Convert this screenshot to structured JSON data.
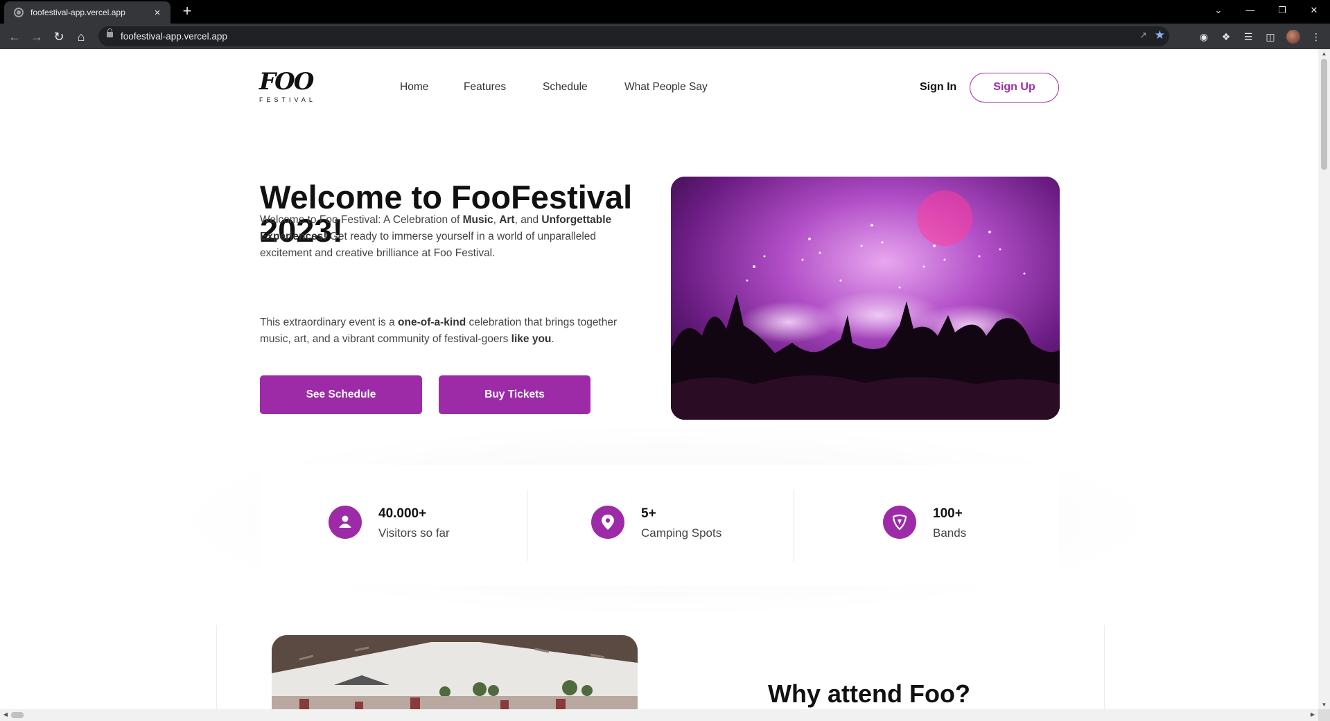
{
  "browser": {
    "tab_title": "foofestival-app.vercel.app",
    "url": "foofestival-app.vercel.app",
    "new_tab": "+",
    "tab_close": "×"
  },
  "site": {
    "logo_script": "FOO",
    "logo_sub": "FESTIVAL",
    "nav": [
      "Home",
      "Features",
      "Schedule",
      "What People Say"
    ],
    "sign_in": "Sign In",
    "sign_up": "Sign Up"
  },
  "hero": {
    "title_prefix": "Welcome to ",
    "title_brand": "FooFestival",
    "title_year": "2023!",
    "p1": {
      "t1": "Welcome to Foo Festival: A Celebration of ",
      "b1": "Music",
      "t2": ", ",
      "b2": "Art",
      "t3": ", and ",
      "b3": "Unforgettable Experiences!",
      "t4": " Get ready to immerse yourself in a world of unparalleled excitement and creative brilliance at Foo Festival."
    },
    "p2": {
      "t1": "This extraordinary event is a ",
      "b1": "one-of-a-kind",
      "t2": " celebration that brings together music, art, and a vibrant community of festival-goers ",
      "b2": "like you",
      "t3": "."
    },
    "btn_schedule": "See Schedule",
    "btn_tickets": "Buy Tickets"
  },
  "stats": [
    {
      "value": "40.000+",
      "label": "Visitors so far",
      "icon": "person-icon"
    },
    {
      "value": "5+",
      "label": "Camping Spots",
      "icon": "location-pin-icon"
    },
    {
      "value": "100+",
      "label": "Bands",
      "icon": "guitar-pick-icon"
    }
  ],
  "section2": {
    "heading": "Why attend Foo?"
  },
  "colors": {
    "accent": "#9d2ba8",
    "chrome_dark": "#35363a",
    "tabbar": "#000000"
  }
}
